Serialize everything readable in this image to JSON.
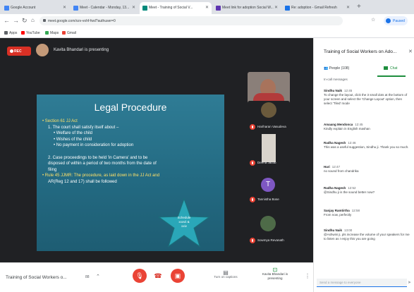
{
  "browser": {
    "tabs": [
      {
        "title": "Google Account",
        "active": false,
        "color": "#4285f4"
      },
      {
        "title": "Meet - Calendar - Monday, 13...",
        "active": false,
        "color": "#4285f4"
      },
      {
        "title": "Meet - Training of Social V...",
        "active": true,
        "color": "#00897b"
      },
      {
        "title": "Meet link for adoption Social W...",
        "active": false,
        "color": "#5e35b1"
      },
      {
        "title": "Re: adoption - Gmail Refresh",
        "active": false,
        "color": "#1a73e8"
      }
    ],
    "url": "meet.google.com/xzv-vohf-fwd?authuser=0",
    "profile_label": "Paused",
    "bookmarks": [
      {
        "label": "Apps",
        "color": "#5f6368"
      },
      {
        "label": "YouTube",
        "color": "#ff0000"
      },
      {
        "label": "Maps",
        "color": "#34a853"
      },
      {
        "label": "Gmail",
        "color": "#ea4335"
      }
    ]
  },
  "stage": {
    "rec_label": "REC",
    "presenting_text": "Kavita Bhandari is presenting"
  },
  "slide": {
    "title": "Legal Procedure",
    "lines": [
      {
        "text": "• Section 61 JJ Act",
        "style": "yellow",
        "indent": 0
      },
      {
        "text": "1. The court shall satisfy itself about –",
        "style": "white",
        "indent": 1
      },
      {
        "text": "• Welfare of the child",
        "style": "white",
        "indent": 2
      },
      {
        "text": "• Wishes of the child",
        "style": "white",
        "indent": 2
      },
      {
        "text": "• No payment in consideration for adoption",
        "style": "white",
        "indent": 2
      },
      {
        "text": "",
        "style": "white",
        "indent": 0
      },
      {
        "text": "2. Case proceedings to be held 'in Camera' and to be",
        "style": "white",
        "indent": 1
      },
      {
        "text": "disposed of within a period of two months from the date of",
        "style": "white",
        "indent": 1
      },
      {
        "text": "filing",
        "style": "white",
        "indent": 1
      },
      {
        "text": "• Rule 45 JJMR: The procedure, as laid down in the JJ Act and",
        "style": "yellow",
        "indent": 0
      },
      {
        "text": "AR(Reg 12 and 17) shall be followed",
        "style": "white",
        "indent": 1
      }
    ],
    "star_text": [
      "Schedule",
      "xxxvii &",
      "xxiv"
    ]
  },
  "participants": [
    {
      "name": "Kavita Bhandari",
      "muted": false
    },
    {
      "name": "Hariharan Vasudeva",
      "muted": true
    },
    {
      "name": "Deena Jacob",
      "muted": true
    },
    {
      "name": "Tannistha Bose",
      "muted": true,
      "initial": "T",
      "avatar_color": "#7e57c2"
    },
    {
      "name": "Sowmya Revanath",
      "muted": true
    }
  ],
  "bottom_bar": {
    "meeting_title": "Training of Social Workers o...",
    "people_count": "88",
    "captions_label": "Turn on captions",
    "presenting_label": "Kavita Bhandari is presenting"
  },
  "panel": {
    "title": "Training of Social Workers on Ado...",
    "people_tab": "People (108)",
    "chat_tab": "Chat",
    "subtitle": "In-call messages",
    "messages": [
      {
        "sender": "Sindhu Naik",
        "time": "12:45",
        "text": "To change the layout, click the 3 small dots at the bottom of your screen and select the 'Change Layout' option, then select 'Tiled' mode"
      },
      {
        "sender": "Amaang Mendonca",
        "time": "12:45",
        "text": "Kindly explain in English mashan"
      },
      {
        "sender": "Radha Nagesh",
        "time": "12:46",
        "text": "This was a useful suggestion, Sindhu ji. Thank you so much."
      },
      {
        "sender": "Hari",
        "time": "12:47",
        "text": "no sound from chandrika"
      },
      {
        "sender": "Radha Nagesh",
        "time": "12:52",
        "text": "@Sindhu ji is the sound better now?"
      },
      {
        "sender": "Sanjay Ramtirtha",
        "time": "12:58",
        "text": "From now, perfectly"
      },
      {
        "sender": "Sindhu Naik",
        "time": "13:00",
        "text": "@Ashwini ji, pls increase the volume of your speakers for me to listen as I enjoy this you are going"
      }
    ],
    "input_placeholder": "Send a message to everyone"
  },
  "colors": {
    "stage_bg": "#202124",
    "slide_bg": "#2a748d",
    "slide_accent": "#ffe169",
    "star": "#2aa7b8",
    "red": "#ea4335",
    "green": "#1e8e3e"
  }
}
